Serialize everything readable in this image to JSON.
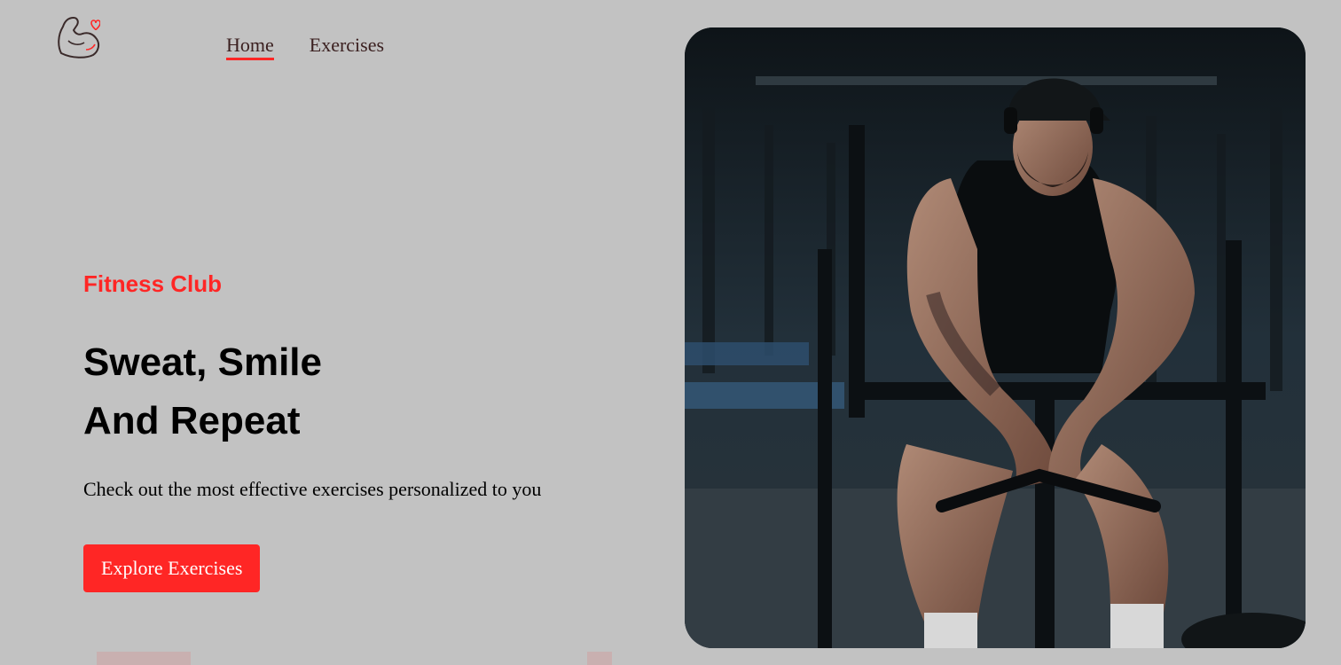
{
  "logo": {
    "icon": "flexed-bicep-heart-icon",
    "accent_color": "#ff2625"
  },
  "nav": {
    "items": [
      {
        "label": "Home",
        "active": true
      },
      {
        "label": "Exercises",
        "active": false
      }
    ]
  },
  "hero": {
    "eyebrow": "Fitness Club",
    "headline_line1": "Sweat, Smile",
    "headline_line2": "And Repeat",
    "subtitle": "Check out the most effective exercises personalized to you",
    "cta_label": "Explore Exercises"
  },
  "image": {
    "name": "banner-image"
  },
  "colors": {
    "background": "#c2c2c2",
    "accent": "#ff2625",
    "text": "#000000",
    "nav_text": "#3a1f1f"
  }
}
